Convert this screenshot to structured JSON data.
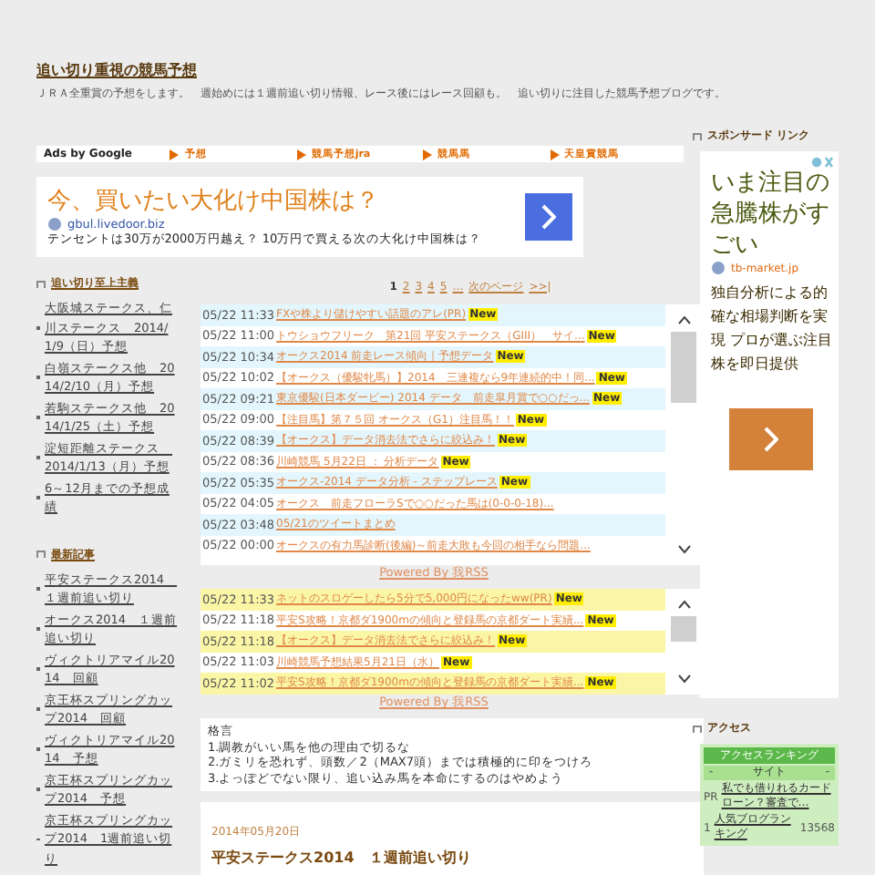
{
  "header": {
    "title": "追い切り重視の競馬予想",
    "description": "ＪＲＡ全重賞の予想をします。　週始めには１週前追い切り情報、レース後にはレース回顧も。　追い切りに注目した競馬予想ブログです。"
  },
  "ad_links": {
    "label": "Ads by Google",
    "links": [
      "予想",
      "競馬予想jra",
      "競馬馬",
      "天皇賞競馬"
    ]
  },
  "top_ad": {
    "headline": "今、買いたい大化け中国株は？",
    "domain": "gbul.livedoor.biz",
    "body": "テンセントは30万が2000万円越え？ 10万円で買える次の大化け中国株は？"
  },
  "sidebar": [
    {
      "heading": "追い切り至上主義",
      "items": [
        "大阪城ステークス、仁川ステークス　2014/1/9（日）予想",
        "白嶺ステークス他　2014/2/10（月）予想",
        "若駒ステークス他　2014/1/25（土）予想",
        "淀短距離ステークス　2014/1/13（月）予想",
        "6～12月までの予想成績"
      ]
    },
    {
      "heading": "最新記事",
      "items": [
        "平安ステークス2014　１週前追い切り",
        "オークス2014　１週前追い切り",
        "ヴィクトリアマイル2014　回顧",
        "京王杯スプリングカップ2014　回顧",
        "ヴィクトリアマイル2014　予想",
        "京王杯スプリングカップ2014　予想",
        "京王杯スプリングカップ2014　1週前追い切り"
      ]
    }
  ],
  "pagination": [
    {
      "label": "1",
      "selected": true
    },
    {
      "label": "2",
      "selected": false
    },
    {
      "label": "3",
      "selected": false
    },
    {
      "label": "4",
      "selected": false
    },
    {
      "label": "5",
      "selected": false
    },
    {
      "label": "…",
      "selected": false
    },
    {
      "label": "次のページ",
      "selected": false
    },
    {
      "label": ">>|",
      "selected": false
    }
  ],
  "feeds": [
    {
      "color": "#e3f6fd",
      "powered": "Powered By 我RSS",
      "rows": [
        {
          "time": "05/22 11:33",
          "title": "FXや株より儲けやすい話題のアレ(PR)",
          "badge": "New"
        },
        {
          "time": "05/22 11:00",
          "title": "トウショウフリーク　第21回 平安ステークス（GIII）　サイ...",
          "badge": "New"
        },
        {
          "time": "05/22 10:34",
          "title": "オークス2014 前走レース傾向｜予想データ",
          "badge": "New"
        },
        {
          "time": "05/22 10:02",
          "title": "【オークス（優駿牝馬）】2014　三連複なら9年連続的中！同...",
          "badge": "New"
        },
        {
          "time": "05/22 09:21",
          "title": "東京優駿(日本ダービー) 2014 データ　前走皐月賞で○○だっ...",
          "badge": "New"
        },
        {
          "time": "05/22 09:00",
          "title": "【注目馬】第７５回 オークス（G1）注目馬！！",
          "badge": "New"
        },
        {
          "time": "05/22 08:39",
          "title": "【オークス】データ消去法でさらに絞込み！",
          "badge": "New"
        },
        {
          "time": "05/22 08:36",
          "title": "川崎競馬 5月22日 ： 分析データ",
          "badge": "New"
        },
        {
          "time": "05/22 05:35",
          "title": "オークス-2014 データ分析 - ステップレース",
          "badge": "New"
        },
        {
          "time": "05/22 04:05",
          "title": "オークス　前走フローラSで○○だった馬は(0-0-0-18)..."
        },
        {
          "time": "05/22 03:48",
          "title": "05/21のツイートまとめ"
        },
        {
          "time": "05/22 00:00",
          "title": "オークスの有力馬診断(後編)～前走大敗も今回の相手なら問題..."
        }
      ]
    },
    {
      "color": "#fbf6a6",
      "powered": "Powered By 我RSS",
      "rows": [
        {
          "time": "05/22 11:33",
          "title": "ネットのスロゲーしたら5分で5,000円になったww(PR)",
          "badge": "New"
        },
        {
          "time": "05/22 11:18",
          "title": "平安S攻略！京都ダ1900mの傾向と登録馬の京都ダート実績...",
          "badge": "New"
        },
        {
          "time": "05/22 11:18",
          "title": "【オークス】データ消去法でさらに絞込み！",
          "badge": "New"
        },
        {
          "time": "05/22 11:03",
          "title": "川崎競馬予想結果5月21日（水）",
          "badge": "New"
        },
        {
          "time": "05/22 11:02",
          "title": "平安S攻略！京都ダ1900mの傾向と登録馬の京都ダート実績...",
          "badge": "New"
        }
      ]
    }
  ],
  "maxims": {
    "heading": "格言",
    "lines": [
      "1.調教がいい馬を他の理由で切るな",
      "2.ガミリを恐れず、頭数／2（MAX7頭）までは積極的に印をつけろ",
      "3.よっぽどでない限り、追い込み馬を本命にするのはやめよう"
    ]
  },
  "article": {
    "date": "2014年05月20日",
    "title": "平安ステークス2014　１週前追い切り"
  },
  "right": {
    "sponsor_heading": "スポンサード リンク",
    "ad": {
      "headline": "いま注目の急騰株がすごい",
      "domain": "tb-market.jp",
      "body": "独自分析による的確な相場判断を実現 プロが選ぶ注目株を即日提供"
    },
    "access_heading": "アクセス",
    "ranking": {
      "title": "アクセスランキング",
      "header": [
        "-",
        "サイト",
        "-"
      ],
      "rows": [
        {
          "rank": "PR",
          "site": "私でも借りれるカードローン？審査で…"
        },
        {
          "rank": "1",
          "site": "人気ブログランキング",
          "count": "13568"
        }
      ]
    }
  }
}
